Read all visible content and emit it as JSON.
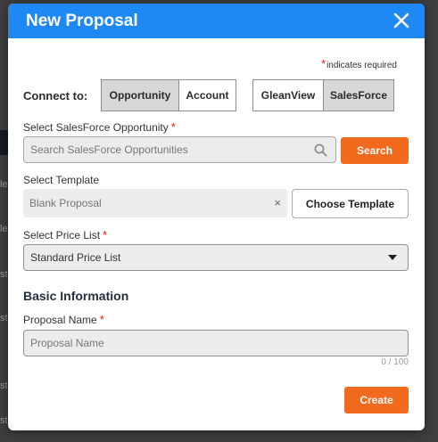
{
  "modal": {
    "title": "New Proposal",
    "required_note": "indicates required"
  },
  "connect": {
    "label": "Connect to:",
    "target_options": [
      "Opportunity",
      "Account"
    ],
    "target_selected": "Opportunity",
    "source_options": [
      "GleanView",
      "SalesForce"
    ],
    "source_selected": "SalesForce"
  },
  "opportunity": {
    "label": "Select SalesForce Opportunity",
    "placeholder": "Search SalesForce Opportunities",
    "search_button": "Search"
  },
  "template": {
    "label": "Select Template",
    "value": "Blank Proposal",
    "clear_glyph": "×",
    "choose_button": "Choose Template"
  },
  "price_list": {
    "label": "Select Price List",
    "value": "Standard Price List"
  },
  "basic_info": {
    "heading": "Basic Information",
    "proposal_name_label": "Proposal Name",
    "proposal_name_placeholder": "Proposal Name",
    "counter": "0 / 100"
  },
  "create_button": "Create",
  "backdrop_fragments": [
    "lect",
    "lect",
    "st",
    "st",
    "st",
    "st"
  ],
  "colors": {
    "header": "#1e88f5",
    "accent": "#f26a1d",
    "required": "#e02020"
  }
}
